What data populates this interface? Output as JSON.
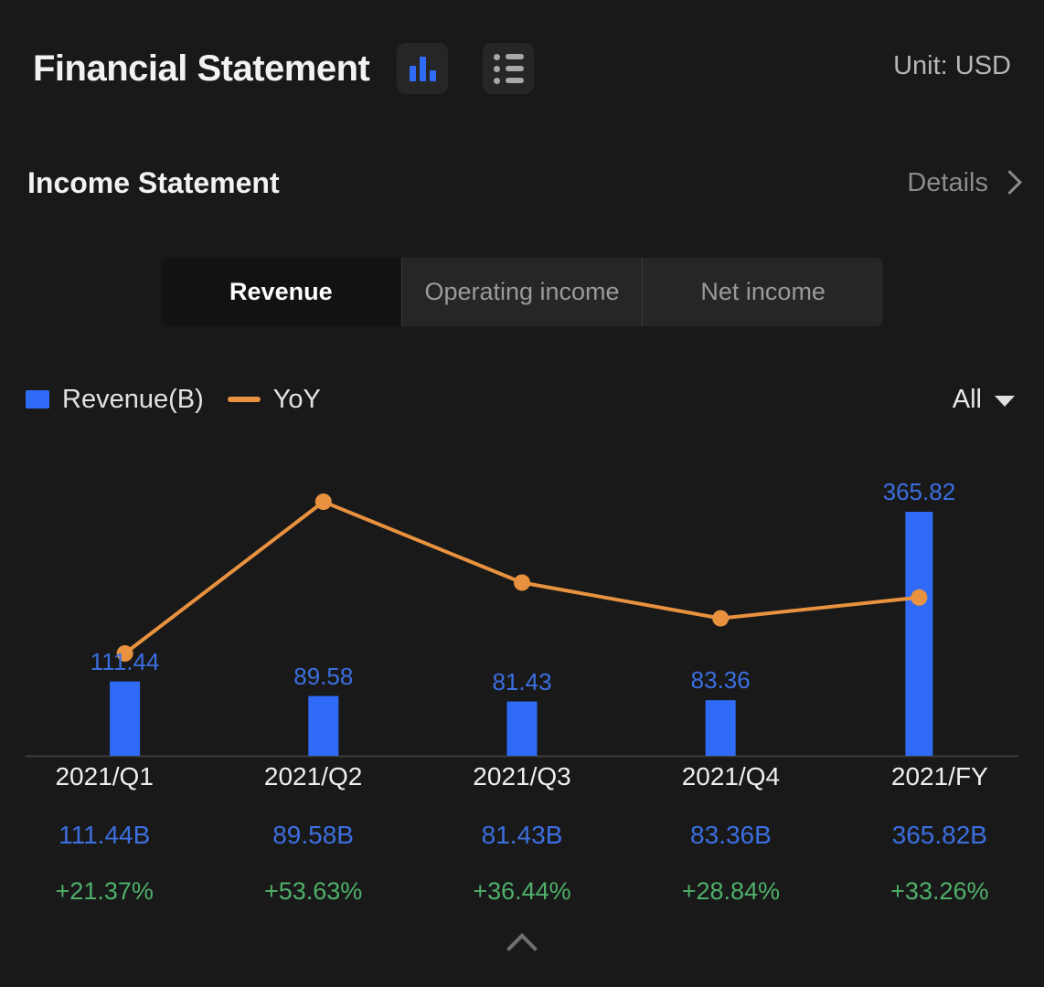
{
  "header": {
    "title": "Financial Statement",
    "chart_view_icon": "bar-chart-icon",
    "list_view_icon": "list-icon",
    "unit_label": "Unit: USD"
  },
  "section": {
    "title": "Income Statement",
    "details_label": "Details",
    "details_chevron_icon": "chevron-right-icon"
  },
  "tabs": [
    {
      "label": "Revenue",
      "active": true
    },
    {
      "label": "Operating income",
      "active": false
    },
    {
      "label": "Net income",
      "active": false
    }
  ],
  "legend": {
    "bar_label": "Revenue(B)",
    "line_label": "YoY",
    "bar_color": "#2f6bf6",
    "line_color": "#e8913f"
  },
  "range_selector": {
    "value": "All",
    "caret_icon": "chevron-down-icon"
  },
  "footer": {
    "collapse_icon": "chevron-up-icon"
  },
  "chart_data": {
    "type": "bar",
    "title": "Income Statement - Revenue",
    "categories": [
      "2021/Q1",
      "2021/Q2",
      "2021/Q3",
      "2021/Q4",
      "2021/FY"
    ],
    "series": [
      {
        "name": "Revenue(B)",
        "type": "bar",
        "color": "#2f6bf6",
        "values": [
          111.44,
          89.58,
          81.43,
          83.36,
          365.82
        ],
        "labels": [
          "111.44",
          "89.58",
          "81.43",
          "83.36",
          "365.82"
        ]
      },
      {
        "name": "YoY",
        "type": "line",
        "color": "#e8913f",
        "values": [
          21.37,
          53.63,
          36.44,
          28.84,
          33.26
        ],
        "labels": [
          "+21.37%",
          "+53.63%",
          "+36.44%",
          "+28.84%",
          "+33.26%"
        ]
      }
    ],
    "xlabel": "",
    "ylabel": "",
    "ylim": [
      0,
      365.82
    ],
    "y2lim": [
      21.37,
      53.63
    ],
    "grid": false,
    "legend_position": "top-left"
  },
  "table": {
    "rows": [
      {
        "period": "2021/Q1",
        "amount": "111.44B",
        "change": "+21.37%"
      },
      {
        "period": "2021/Q2",
        "amount": "89.58B",
        "change": "+53.63%"
      },
      {
        "period": "2021/Q3",
        "amount": "81.43B",
        "change": "+36.44%"
      },
      {
        "period": "2021/Q4",
        "amount": "83.36B",
        "change": "+28.84%"
      },
      {
        "period": "2021/FY",
        "amount": "365.82B",
        "change": "+33.26%"
      }
    ]
  }
}
